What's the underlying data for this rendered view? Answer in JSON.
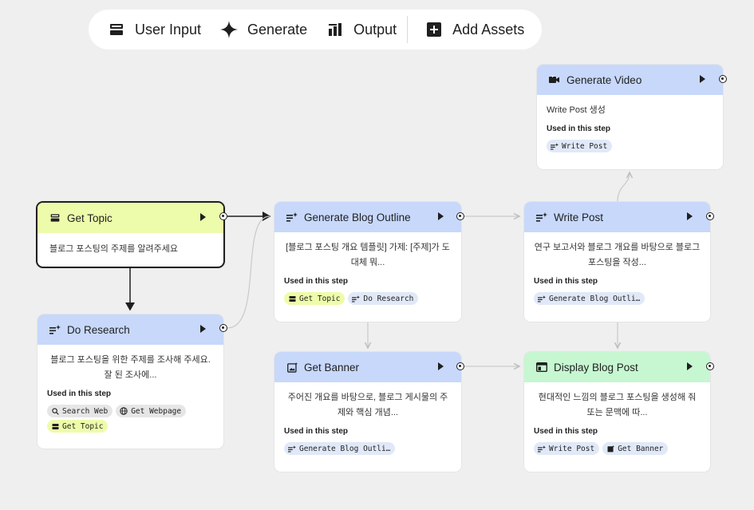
{
  "toolbar": {
    "user_input": "User Input",
    "generate": "Generate",
    "output": "Output",
    "add_assets": "Add Assets"
  },
  "used_label": "Used in this step",
  "nodes": {
    "get_topic": {
      "title": "Get Topic",
      "desc": "블로그 포스팅의 주제를 알려주세요"
    },
    "do_research": {
      "title": "Do Research",
      "desc": "블로그 포스팅을 위한 주제를 조사해 주세요. 잘 된 조사에...",
      "chips": [
        "Search Web",
        "Get Webpage",
        "Get Topic"
      ]
    },
    "generate_blog_outline": {
      "title": "Generate Blog Outline",
      "desc": "[블로그 포스팅 개요 템플릿] 가제: [주제]가 도대체 뭐...",
      "chips": [
        "Get Topic",
        "Do Research"
      ]
    },
    "get_banner": {
      "title": "Get Banner",
      "desc": "주어진 개요를 바탕으로, 블로그 게시물의 주제와 핵심 개념...",
      "chips": [
        "Generate Blog Outli…"
      ]
    },
    "write_post": {
      "title": "Write Post",
      "desc": "연구 보고서와 블로그 개요를 바탕으로 블로그 포스팅을 작성...",
      "chips": [
        "Generate Blog Outli…"
      ]
    },
    "generate_video": {
      "title": "Generate Video",
      "desc": "Write Post 생성",
      "chips": [
        "Write Post"
      ]
    },
    "display_blog_post": {
      "title": "Display Blog Post",
      "desc": "현대적인 느낌의 블로그 포스팅을 생성해 줘 또는 문맥에 따...",
      "chips": [
        "Write Post",
        "Get Banner"
      ]
    }
  }
}
